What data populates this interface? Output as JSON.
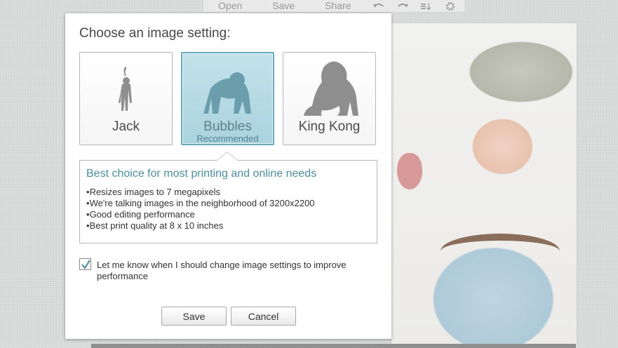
{
  "toolbar": {
    "open_label": "Open",
    "save_label": "Save",
    "share_label": "Share",
    "icons": [
      "undo-icon",
      "redo-icon",
      "sort-icon",
      "gear-icon"
    ]
  },
  "dialog": {
    "title": "Choose an image setting:",
    "options": [
      {
        "label": "Jack",
        "sublabel": "",
        "icon": "monkey-icon",
        "selected": false
      },
      {
        "label": "Bubbles",
        "sublabel": "Recommended",
        "icon": "chimp-icon",
        "selected": true
      },
      {
        "label": "King Kong",
        "sublabel": "",
        "icon": "gorilla-icon",
        "selected": false
      }
    ],
    "description": {
      "heading": "Best choice for most printing and online needs",
      "bullets": [
        "Resizes images to 7 megapixels",
        "We're talking images in the neighborhood of 3200x2200",
        "Good editing performance",
        "Best print quality at 8 x 10 inches"
      ]
    },
    "notify_checkbox": {
      "checked": true,
      "label": "Let me know when I should change image settings to improve performance"
    },
    "save_label": "Save",
    "cancel_label": "Cancel"
  },
  "colors": {
    "accent": "#4e8ea1",
    "selected_bg": "#b6dae3",
    "selected_border": "#6aa8bb"
  }
}
